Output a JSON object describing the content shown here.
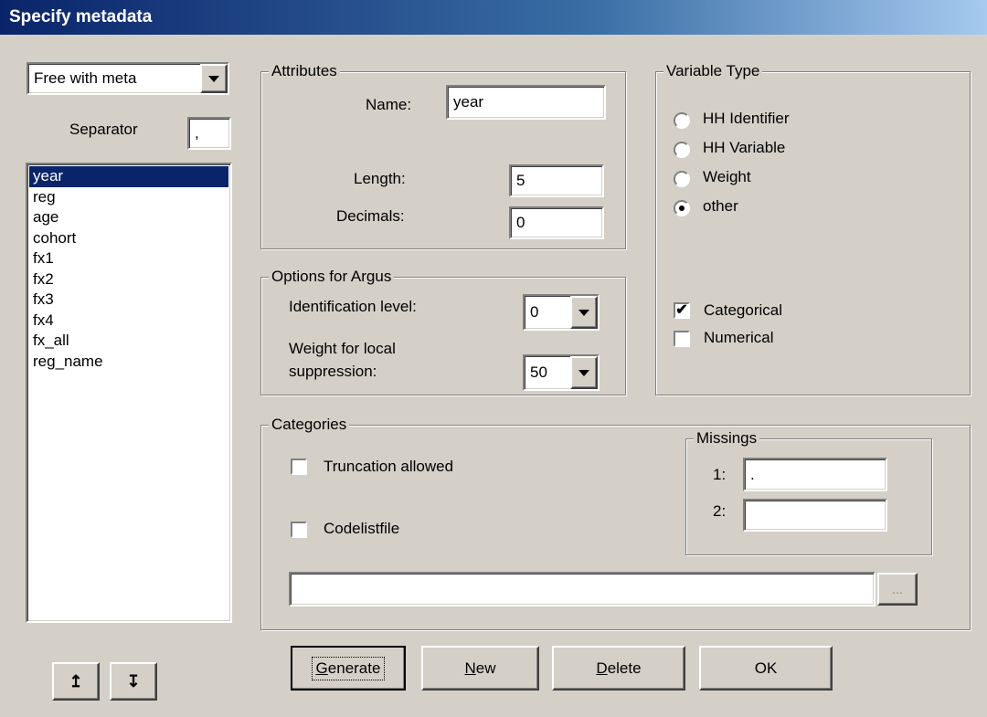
{
  "window": {
    "title": "Specify metadata"
  },
  "format_select": {
    "value": "Free with meta"
  },
  "separator": {
    "label": "Separator",
    "value": ","
  },
  "variables": {
    "items": [
      "year",
      "reg",
      "age",
      "cohort",
      "fx1",
      "fx2",
      "fx3",
      "fx4",
      "fx_all",
      "reg_name"
    ],
    "selected": "year"
  },
  "attributes": {
    "legend": "Attributes",
    "name_label": "Name:",
    "name_value": "year",
    "length_label": "Length:",
    "length_value": "5",
    "decimals_label": "Decimals:",
    "decimals_value": "0"
  },
  "argus": {
    "legend": "Options for Argus",
    "id_level_label": "Identification level:",
    "id_level_value": "0",
    "weight_label_line1": "Weight for local",
    "weight_label_line2": "suppression:",
    "weight_value": "50"
  },
  "variable_type": {
    "legend": "Variable Type",
    "options": [
      "HH Identifier",
      "HH Variable",
      "Weight",
      "other"
    ],
    "selected": "other",
    "categorical_label": "Categorical",
    "categorical_checked": true,
    "numerical_label": "Numerical",
    "numerical_checked": false
  },
  "categories": {
    "legend": "Categories",
    "truncation_label": "Truncation allowed",
    "truncation_checked": false,
    "codelist_label": "Codelistfile",
    "codelist_checked": false,
    "codelist_path": "",
    "browse_label": "...",
    "missings": {
      "legend": "Missings",
      "label1": "1:",
      "value1": ".",
      "label2": "2:",
      "value2": ""
    }
  },
  "buttons": {
    "up_icon": "arrow-up-icon",
    "down_icon": "arrow-down-icon",
    "generate": "Generate",
    "new": "New",
    "delete": "Delete",
    "ok": "OK"
  },
  "colors": {
    "titlebar": "#0a246a",
    "face": "#d4d0c8",
    "selection": "#0a246a"
  }
}
